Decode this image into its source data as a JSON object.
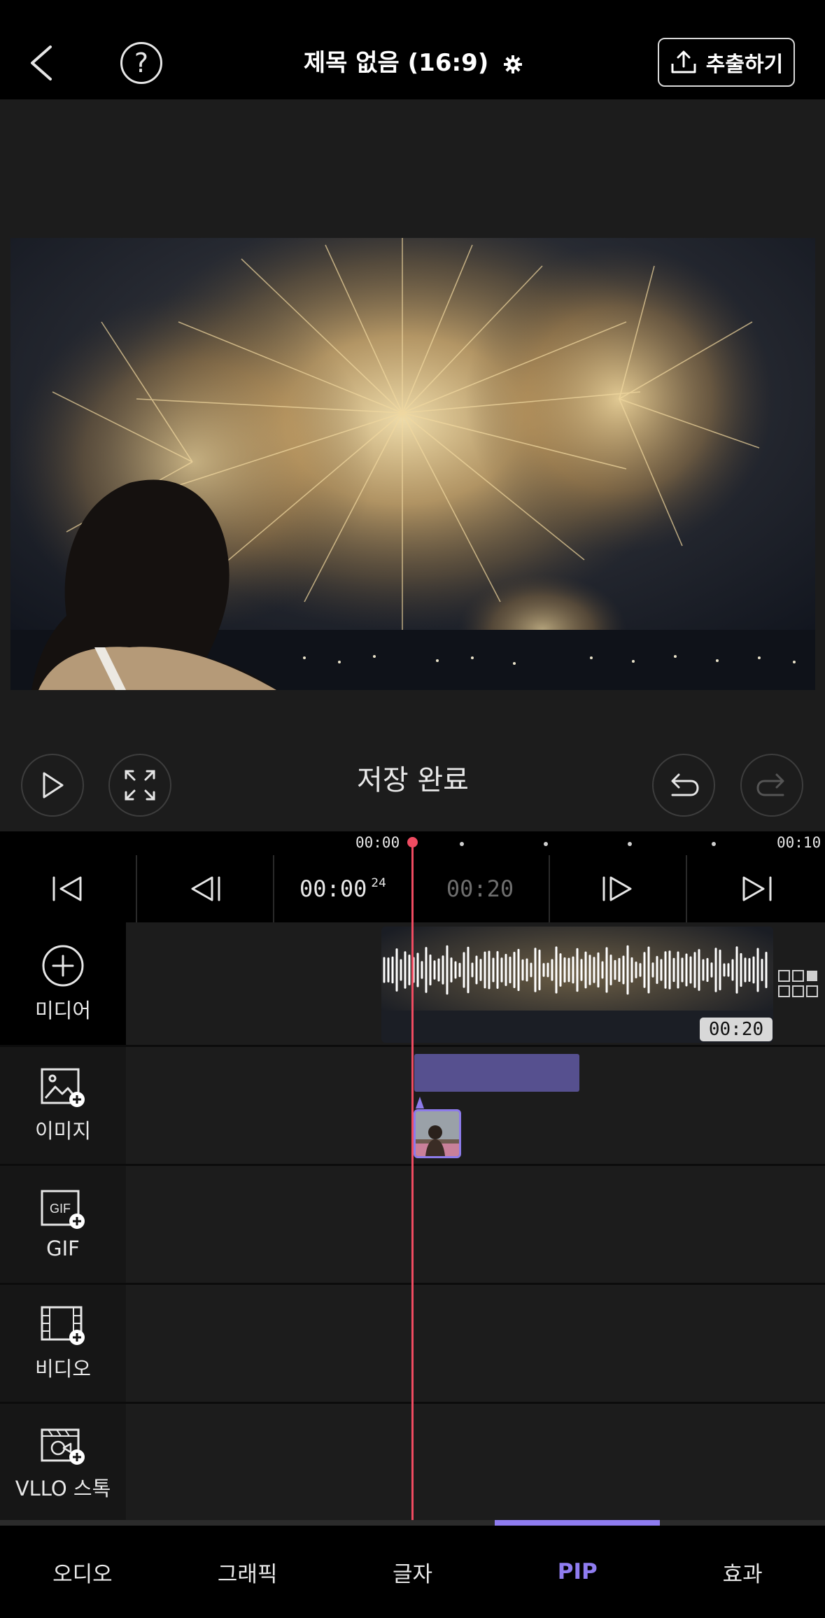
{
  "header": {
    "title": "제목 없음 (16:9)",
    "export_label": "추출하기",
    "help_glyph": "?"
  },
  "player": {
    "save_status": "저장 완료"
  },
  "ruler": {
    "start_label": "00:00",
    "end_label": "00:10"
  },
  "transport": {
    "current_time": "00:00",
    "current_frame": "24",
    "total_time": "00:20"
  },
  "tracks": {
    "media_label": "미디어",
    "image_label": "이미지",
    "gif_label": "GIF",
    "gif_icon_text": "GIF",
    "video_label": "비디오",
    "stock_label": "VLLO 스톡",
    "media_clip_duration": "00:20"
  },
  "tabs": [
    "오디오",
    "그래픽",
    "글자",
    "PIP",
    "효과"
  ],
  "active_tab": "PIP",
  "colors": {
    "accent": "#8f7cf0",
    "playhead": "#ef4b61",
    "pip_clip": "#56508f"
  }
}
